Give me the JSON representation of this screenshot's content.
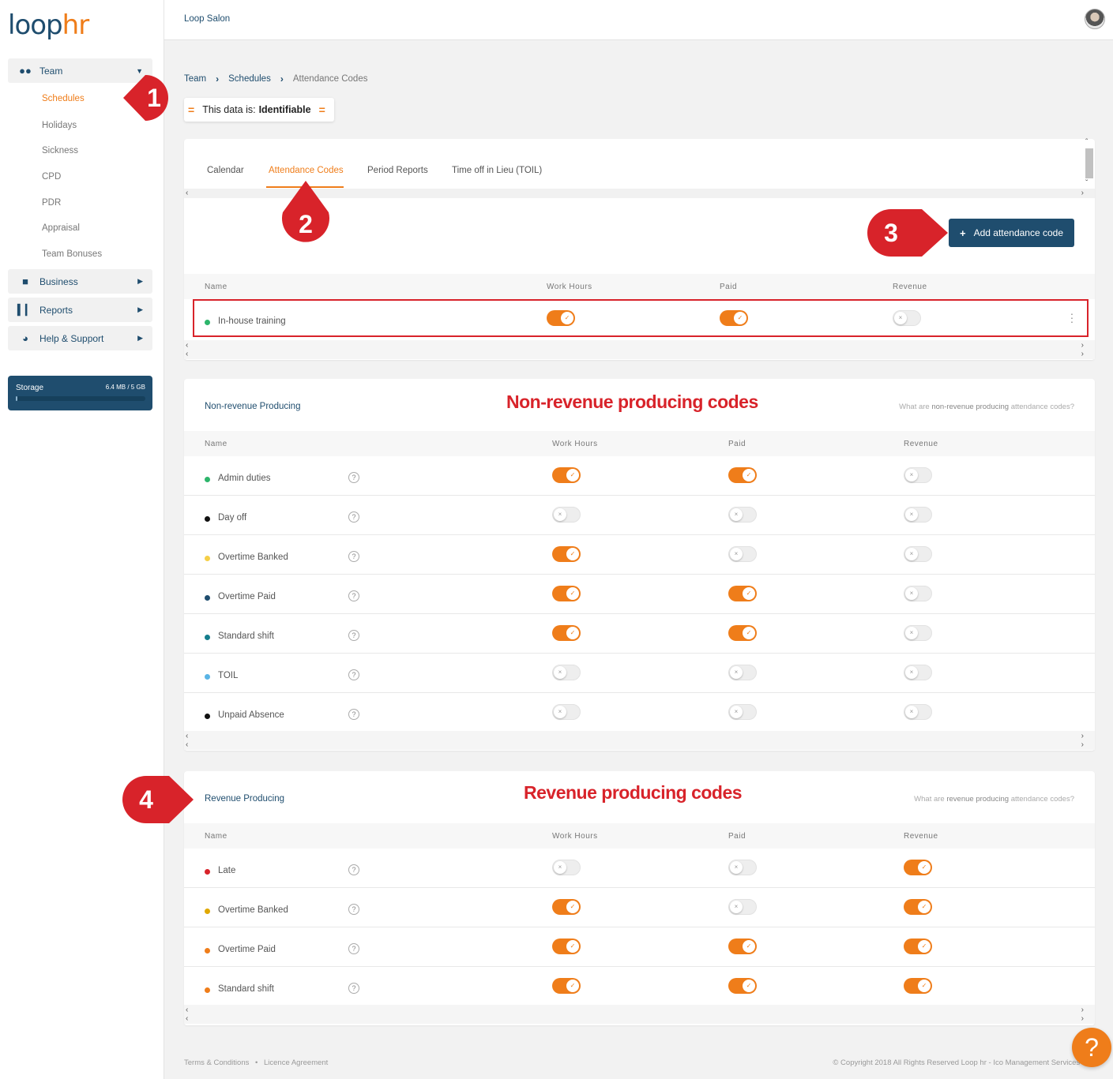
{
  "brand": {
    "logo_loop": "loop",
    "logo_hr": "hr"
  },
  "header": {
    "organisation": "Loop Salon"
  },
  "sidebar": {
    "sections": [
      {
        "label": "Team",
        "icon": "team-icon",
        "expanded": true
      },
      {
        "label": "Business",
        "icon": "briefcase-icon"
      },
      {
        "label": "Reports",
        "icon": "bar-chart-icon"
      },
      {
        "label": "Help & Support",
        "icon": "globe-icon"
      }
    ],
    "team_items": [
      "Schedules",
      "Holidays",
      "Sickness",
      "CPD",
      "PDR",
      "Appraisal",
      "Team Bonuses"
    ],
    "active_item": "Schedules",
    "storage": {
      "label": "Storage",
      "value": "6.4 MB / 5 GB",
      "fraction_used": 0.001
    }
  },
  "breadcrumb": {
    "items": [
      "Team",
      "Schedules",
      "Attendance Codes"
    ]
  },
  "data_classification": {
    "prefix": "This data is:",
    "level": "Identifiable"
  },
  "tabs": {
    "items": [
      "Calendar",
      "Attendance Codes",
      "Period Reports",
      "Time off in Lieu (TOIL)"
    ],
    "active": "Attendance Codes"
  },
  "add_button": {
    "label": "Add attendance code"
  },
  "columns": {
    "name": "Name",
    "work_hours": "Work Hours",
    "paid": "Paid",
    "revenue": "Revenue"
  },
  "custom_codes": {
    "rows": [
      {
        "name": "In-house training",
        "dot": "#2db56b",
        "work_hours": true,
        "paid": true,
        "revenue": false
      }
    ]
  },
  "non_revenue": {
    "title": "Non-revenue Producing",
    "help_prefix": "What are ",
    "help_bold": "non-revenue producing",
    "help_suffix": " attendance codes?",
    "rows": [
      {
        "name": "Admin duties",
        "dot": "#2db56b",
        "work_hours": true,
        "paid": true,
        "revenue": false
      },
      {
        "name": "Day off",
        "dot": "#111111",
        "work_hours": false,
        "paid": false,
        "revenue": false
      },
      {
        "name": "Overtime Banked",
        "dot": "#f5cf47",
        "work_hours": true,
        "paid": false,
        "revenue": false
      },
      {
        "name": "Overtime Paid",
        "dot": "#1f4d6e",
        "work_hours": true,
        "paid": true,
        "revenue": false
      },
      {
        "name": "Standard shift",
        "dot": "#147d8c",
        "work_hours": true,
        "paid": true,
        "revenue": false
      },
      {
        "name": "TOIL",
        "dot": "#5ab4e5",
        "work_hours": false,
        "paid": false,
        "revenue": false
      },
      {
        "name": "Unpaid Absence",
        "dot": "#111111",
        "work_hours": false,
        "paid": false,
        "revenue": false
      }
    ]
  },
  "revenue": {
    "title": "Revenue Producing",
    "help_prefix": "What are ",
    "help_bold": "revenue producing",
    "help_suffix": " attendance codes?",
    "rows": [
      {
        "name": "Late",
        "dot": "#d8232a",
        "work_hours": false,
        "paid": false,
        "revenue": true
      },
      {
        "name": "Overtime Banked",
        "dot": "#e0a800",
        "work_hours": true,
        "paid": false,
        "revenue": true
      },
      {
        "name": "Overtime Paid",
        "dot": "#ef7d1a",
        "work_hours": true,
        "paid": true,
        "revenue": true
      },
      {
        "name": "Standard shift",
        "dot": "#ef7d1a",
        "work_hours": true,
        "paid": true,
        "revenue": true
      }
    ]
  },
  "annotations": {
    "non_revenue_label": "Non-revenue producing codes",
    "revenue_label": "Revenue producing codes",
    "markers": [
      "1",
      "2",
      "3",
      "4"
    ],
    "marker_color": "#d8232a"
  },
  "footer": {
    "terms": "Terms & Conditions",
    "separator": "•",
    "licence": "Licence Agreement",
    "copyright": "© Copyright 2018 All Rights Reserved Loop hr - Ico Management Services Ltd"
  },
  "help_fab": {
    "label": "?"
  },
  "colors": {
    "accent": "#ef7d1a",
    "brand": "#1f4d6e",
    "annotation": "#d8232a"
  }
}
